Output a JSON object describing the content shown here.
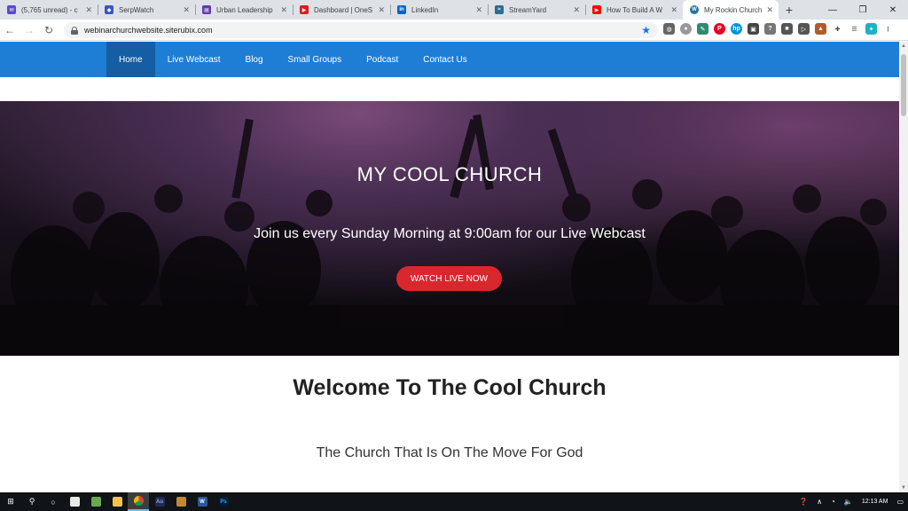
{
  "browser": {
    "tabs": [
      {
        "title": "(5,765 unread) - c",
        "favicon": "mail-icon",
        "color": "#5c4bc7"
      },
      {
        "title": "SerpWatch",
        "favicon": "serpwatch-icon",
        "color": "#3a56c2"
      },
      {
        "title": "Urban Leadership",
        "favicon": "page-icon",
        "color": "#5b3fa8"
      },
      {
        "title": "Dashboard | OneS",
        "favicon": "play-icon",
        "color": "#d61e1e"
      },
      {
        "title": "LinkedIn",
        "favicon": "linkedin-icon",
        "color": "#0a66c2"
      },
      {
        "title": "StreamYard",
        "favicon": "streamyard-icon",
        "color": "#2c6e8c"
      },
      {
        "title": "How To Build A W",
        "favicon": "youtube-icon",
        "color": "#ff0000"
      },
      {
        "title": "My Rockin Church",
        "favicon": "wordpress-icon",
        "color": "#21759b",
        "active": true
      }
    ],
    "new_tab": "+",
    "url": "webinarchurchwebsite.siterubix.com"
  },
  "site": {
    "nav": [
      "Home",
      "Live Webcast",
      "Blog",
      "Small Groups",
      "Podcast",
      "Contact Us"
    ],
    "active_nav": "Home",
    "hero": {
      "title": "MY COOL CHURCH",
      "subtitle": "Join us every Sunday Morning at 9:00am for our Live Webcast",
      "button": "WATCH LIVE NOW"
    },
    "welcome": "Welcome To The Cool Church",
    "tagline": "The Church That Is On The Move For God",
    "colors": {
      "nav": "#1e7ed6",
      "nav_active": "#155ea3",
      "button": "#d9272e"
    }
  },
  "taskbar": {
    "clock": "12:13 AM"
  }
}
